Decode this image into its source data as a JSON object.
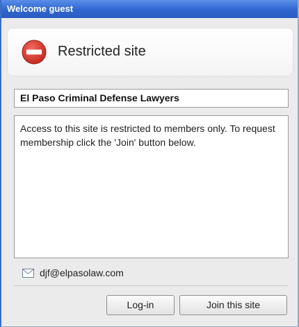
{
  "window": {
    "title": "Welcome guest"
  },
  "header": {
    "title": "Restricted site",
    "icon": "no-entry-icon",
    "icon_color": "#d9362b"
  },
  "site": {
    "name": "El Paso Criminal Defense Lawyers"
  },
  "message": {
    "text": "Access to this site is restricted to members only. To request membership click the 'Join' button below."
  },
  "contact": {
    "email": "djf@elpasolaw.com",
    "icon": "mail-icon"
  },
  "buttons": {
    "login_label": "Log-in",
    "join_label": "Join this site"
  },
  "colors": {
    "titlebar": "#2f66cf",
    "background": "#ebebeb"
  }
}
